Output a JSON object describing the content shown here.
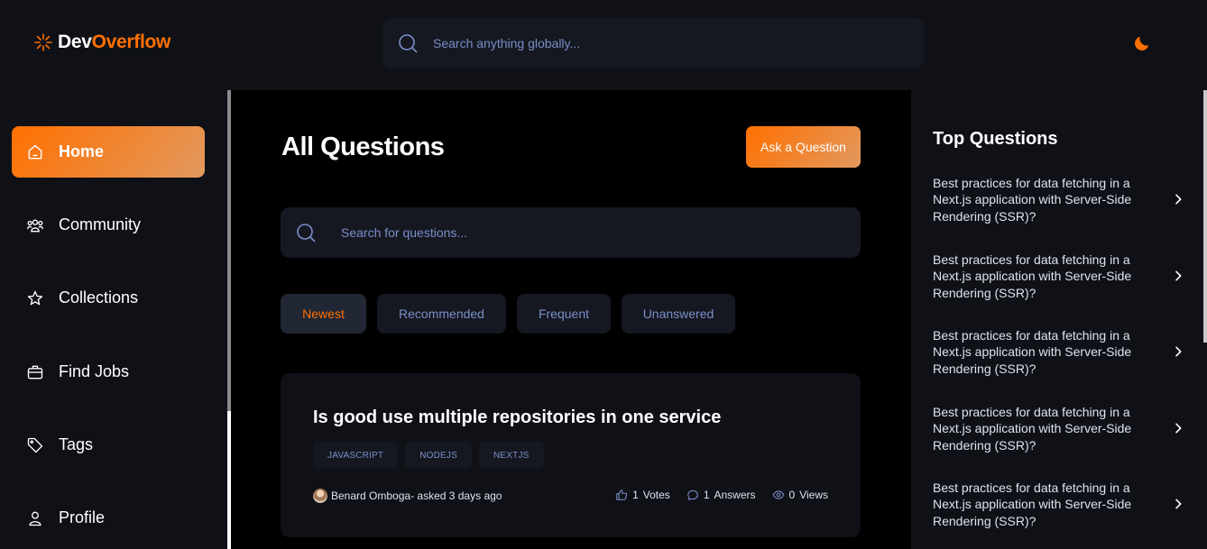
{
  "brand": {
    "part1": "Dev",
    "part2": "Overflow",
    "accent": "#ff7000"
  },
  "global_search": {
    "placeholder": "Search anything globally...",
    "icon": "search-icon"
  },
  "theme_toggle": {
    "icon": "moon-icon"
  },
  "sidebar": {
    "items": [
      {
        "label": "Home",
        "icon": "home-icon",
        "active": true
      },
      {
        "label": "Community",
        "icon": "users-icon",
        "active": false
      },
      {
        "label": "Collections",
        "icon": "star-icon",
        "active": false
      },
      {
        "label": "Find Jobs",
        "icon": "suitcase-icon",
        "active": false
      },
      {
        "label": "Tags",
        "icon": "tag-icon",
        "active": false
      },
      {
        "label": "Profile",
        "icon": "user-icon",
        "active": false
      }
    ]
  },
  "main": {
    "title": "All Questions",
    "ask_label": "Ask a Question",
    "search_placeholder": "Search for questions...",
    "filters": [
      {
        "label": "Newest",
        "active": true
      },
      {
        "label": "Recommended",
        "active": false
      },
      {
        "label": "Frequent",
        "active": false
      },
      {
        "label": "Unanswered",
        "active": false
      }
    ],
    "question": {
      "title": "Is good use multiple repositories in one service",
      "tags": [
        "javascript",
        "nodejs",
        "nextjs"
      ],
      "author": "Benard Omboga",
      "asked": " - asked 3 days ago",
      "votes": "1",
      "votes_label": "Votes",
      "answers": "1",
      "answers_label": "Answers",
      "views": "0",
      "views_label": "Views"
    }
  },
  "rightbar": {
    "title": "Top Questions",
    "questions": [
      "Best practices for data fetching in a Next.js application with Server-Side Rendering (SSR)?",
      "Best practices for data fetching in a Next.js application with Server-Side Rendering (SSR)?",
      "Best practices for data fetching in a Next.js application with Server-Side Rendering (SSR)?",
      "Best practices for data fetching in a Next.js application with Server-Side Rendering (SSR)?",
      "Best practices for data fetching in a Next.js application with Server-Side Rendering (SSR)?"
    ]
  }
}
